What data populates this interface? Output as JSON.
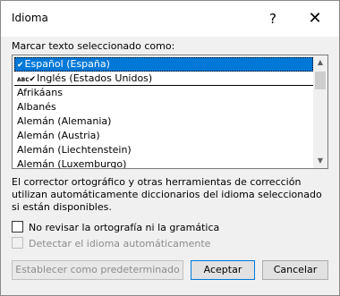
{
  "dialog": {
    "title": "Idioma"
  },
  "titlebar": {
    "help_glyph": "?",
    "close_glyph": "✕"
  },
  "mark_label": "Marcar texto seleccionado como:",
  "languages": [
    {
      "prefix": "",
      "label": "Español (España)"
    },
    {
      "prefix": "ABC",
      "label": "Inglés (Estados Unidos)"
    },
    {
      "prefix": "",
      "label": "Afrikáans"
    },
    {
      "prefix": "",
      "label": "Albanés"
    },
    {
      "prefix": "",
      "label": "Alemán (Alemania)"
    },
    {
      "prefix": "",
      "label": "Alemán (Austria)"
    },
    {
      "prefix": "",
      "label": "Alemán (Liechtenstein)"
    },
    {
      "prefix": "",
      "label": "Alemán (Luxemburgo)"
    }
  ],
  "scrollbar": {
    "up_glyph": "▲",
    "down_glyph": "▼"
  },
  "info_text": "El corrector ortográfico y otras herramientas de corrección utilizan automáticamente diccionarios del idioma seleccionado si están disponibles.",
  "options": {
    "no_check": {
      "label": "No revisar la ortografía ni la gramática",
      "checked": false
    },
    "detect": {
      "label": "Detectar el idioma automáticamente",
      "checked": false,
      "disabled": true
    }
  },
  "buttons": {
    "set_default": "Establecer como predeterminado",
    "accept": "Aceptar",
    "cancel": "Cancelar"
  },
  "colors": {
    "selection": "#0078d7",
    "dialog_bg": "#f0f0f0"
  }
}
